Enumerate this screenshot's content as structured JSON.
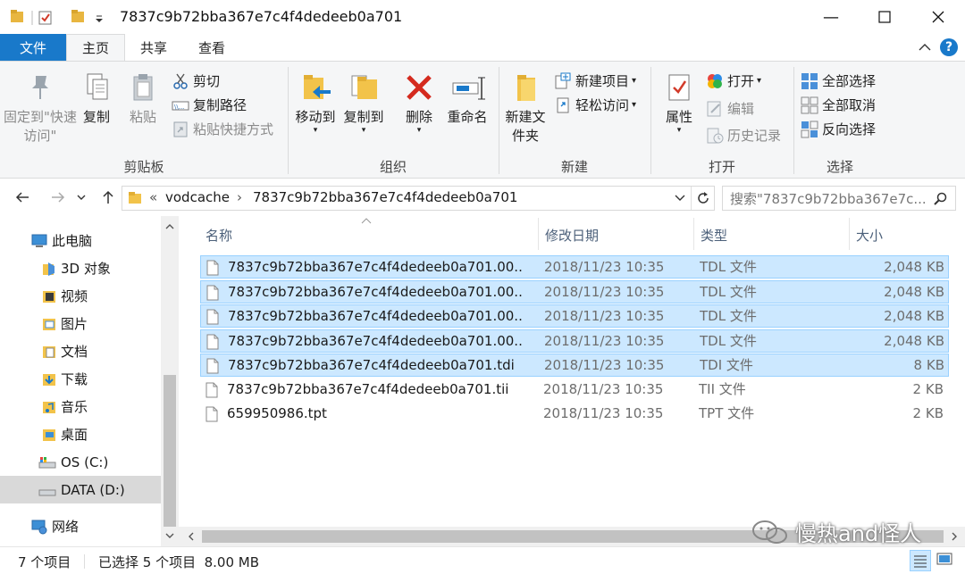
{
  "window": {
    "title": "7837c9b72bba367e7c4f4dedeeb0a701"
  },
  "tabs": [
    {
      "label": "文件"
    },
    {
      "label": "主页"
    },
    {
      "label": "共享"
    },
    {
      "label": "查看"
    }
  ],
  "ribbon": {
    "clipboard": {
      "label": "剪贴板",
      "pin": "固定到\"快速访问\"",
      "copy": "复制",
      "paste": "粘贴",
      "cut": "剪切",
      "copy_path": "复制路径",
      "paste_shortcut": "粘贴快捷方式"
    },
    "organize": {
      "label": "组织",
      "move_to": "移动到",
      "copy_to": "复制到",
      "delete": "删除",
      "rename": "重命名"
    },
    "new": {
      "label": "新建",
      "new_folder": "新建文件夹",
      "new_item": "新建项目",
      "easy_access": "轻松访问"
    },
    "open": {
      "label": "打开",
      "properties": "属性",
      "open": "打开",
      "edit": "编辑",
      "history": "历史记录"
    },
    "select": {
      "label": "选择",
      "select_all": "全部选择",
      "select_none": "全部取消",
      "invert": "反向选择"
    }
  },
  "address": {
    "overflow": "«",
    "crumbs": [
      "vodcache",
      "7837c9b72bba367e7c4f4dedeeb0a701"
    ],
    "search_placeholder": "搜索\"7837c9b72bba367e7c..."
  },
  "nav": [
    {
      "label": "此电脑",
      "icon": "computer-icon"
    },
    {
      "label": "3D 对象",
      "icon": "3d-objects-icon"
    },
    {
      "label": "视频",
      "icon": "videos-icon"
    },
    {
      "label": "图片",
      "icon": "pictures-icon"
    },
    {
      "label": "文档",
      "icon": "documents-icon"
    },
    {
      "label": "下载",
      "icon": "downloads-icon"
    },
    {
      "label": "音乐",
      "icon": "music-icon"
    },
    {
      "label": "桌面",
      "icon": "desktop-icon"
    },
    {
      "label": "OS (C:)",
      "icon": "drive-icon"
    },
    {
      "label": "DATA (D:)",
      "icon": "drive-icon"
    },
    {
      "label": "网络",
      "icon": "network-icon"
    }
  ],
  "columns": {
    "name": "名称",
    "date": "修改日期",
    "type": "类型",
    "size": "大小"
  },
  "files": [
    {
      "name": "7837c9b72bba367e7c4f4dedeeb0a701.00...",
      "date": "2018/11/23 10:35",
      "type": "TDL 文件",
      "size": "2,048 KB",
      "selected": true
    },
    {
      "name": "7837c9b72bba367e7c4f4dedeeb0a701.00...",
      "date": "2018/11/23 10:35",
      "type": "TDL 文件",
      "size": "2,048 KB",
      "selected": true
    },
    {
      "name": "7837c9b72bba367e7c4f4dedeeb0a701.00...",
      "date": "2018/11/23 10:35",
      "type": "TDL 文件",
      "size": "2,048 KB",
      "selected": true
    },
    {
      "name": "7837c9b72bba367e7c4f4dedeeb0a701.00...",
      "date": "2018/11/23 10:35",
      "type": "TDL 文件",
      "size": "2,048 KB",
      "selected": true
    },
    {
      "name": "7837c9b72bba367e7c4f4dedeeb0a701.tdi",
      "date": "2018/11/23 10:35",
      "type": "TDI 文件",
      "size": "8 KB",
      "selected": true
    },
    {
      "name": "7837c9b72bba367e7c4f4dedeeb0a701.tii",
      "date": "2018/11/23 10:35",
      "type": "TII 文件",
      "size": "2 KB",
      "selected": false
    },
    {
      "name": "659950986.tpt",
      "date": "2018/11/23 10:35",
      "type": "TPT 文件",
      "size": "2 KB",
      "selected": false
    }
  ],
  "status": {
    "count": "7 个项目",
    "selected": "已选择 5 个项目  8.00 MB"
  },
  "watermark": "慢热and怪人"
}
